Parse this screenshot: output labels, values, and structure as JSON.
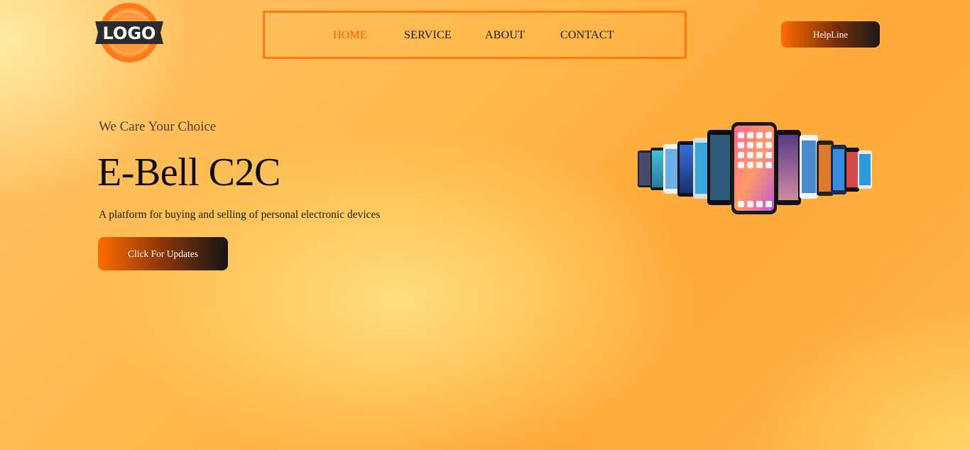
{
  "logo": {
    "text": "LOGO",
    "colors": {
      "ring": "#ff7a1a",
      "ribbon": "#2b2b2b",
      "letters": "#ffffff"
    }
  },
  "nav": {
    "items": [
      {
        "label": "HOME",
        "active": true
      },
      {
        "label": "SERVICE",
        "active": false
      },
      {
        "label": "ABOUT",
        "active": false
      },
      {
        "label": "CONTACT",
        "active": false
      }
    ],
    "border_color": "#ff7a10",
    "active_color": "#ff5a00"
  },
  "helpline": {
    "label": "HelpLine"
  },
  "hero": {
    "tagline": "We Care Your Choice",
    "title": "E-Bell C2C",
    "description": "A platform for buying and selling of personal electronic devices",
    "cta_label": "Click For Updates",
    "illustration": "smartphones-fan"
  },
  "colors": {
    "accent": "#ff6a00",
    "background": "#ffb548",
    "button_gradient_end": "#151515"
  }
}
